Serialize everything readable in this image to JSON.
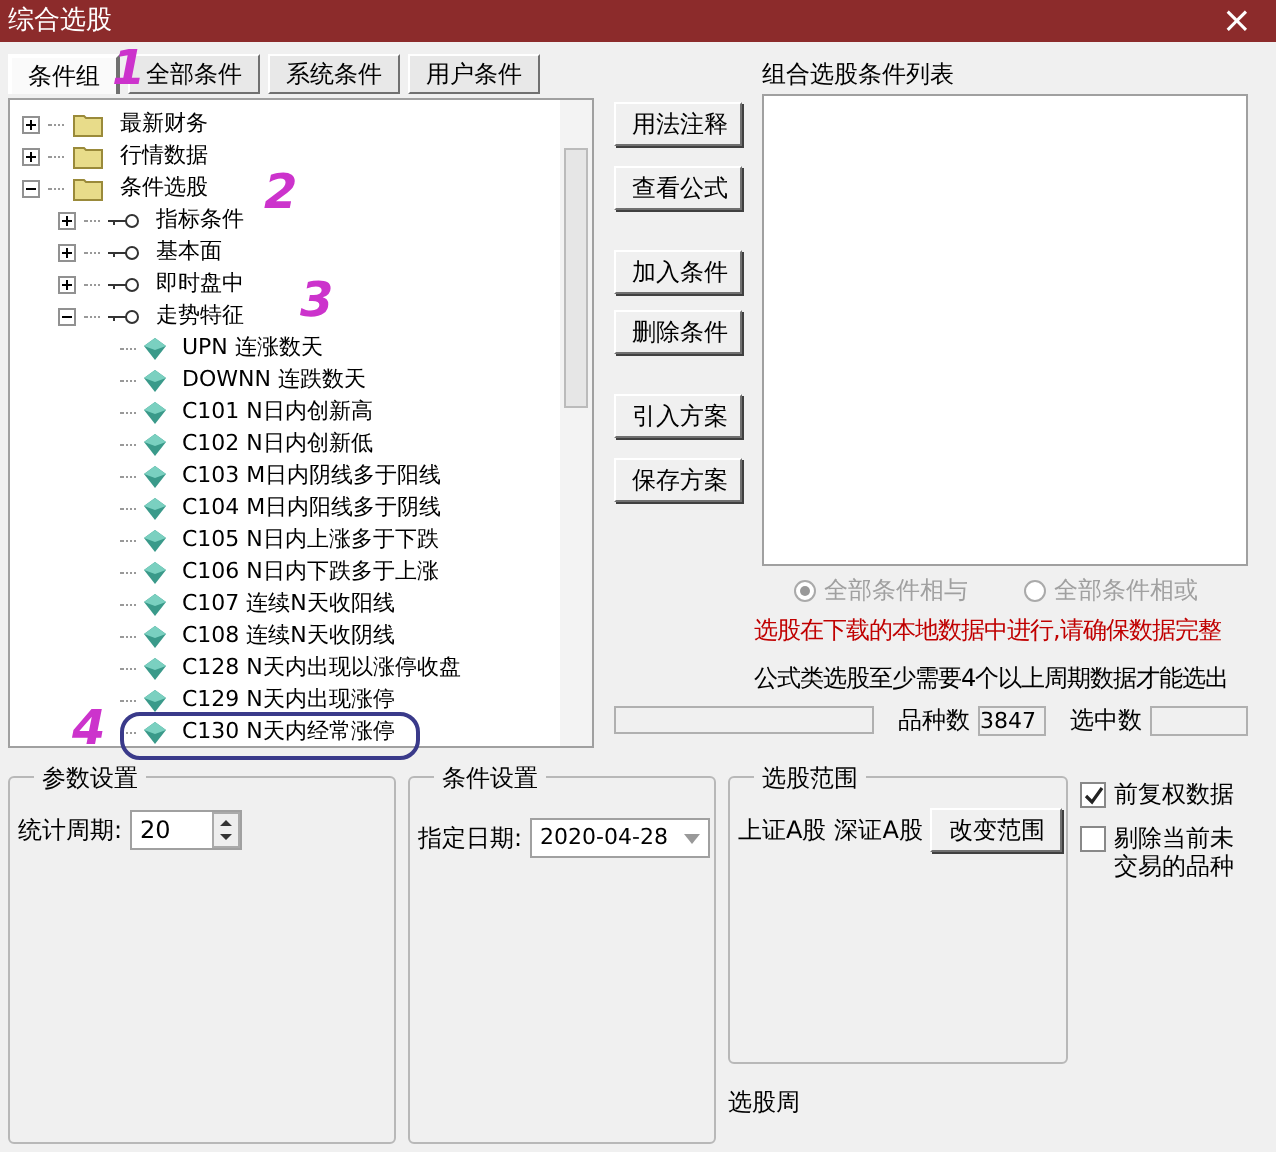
{
  "window": {
    "title": "综合选股",
    "close": "×"
  },
  "tabs": [
    {
      "label": "条件组",
      "selected": true
    },
    {
      "label": "全部条件",
      "selected": false
    },
    {
      "label": "系统条件",
      "selected": false
    },
    {
      "label": "用户条件",
      "selected": false
    }
  ],
  "tree": [
    {
      "kind": "folder",
      "label": "最新财务",
      "expanded": false
    },
    {
      "kind": "folder",
      "label": "行情数据",
      "expanded": false
    },
    {
      "kind": "folder",
      "label": "条件选股",
      "expanded": true,
      "children": [
        {
          "kind": "group",
          "label": "指标条件",
          "expanded": false
        },
        {
          "kind": "group",
          "label": "基本面",
          "expanded": false
        },
        {
          "kind": "group",
          "label": "即时盘中",
          "expanded": false
        },
        {
          "kind": "group",
          "label": "走势特征",
          "expanded": true,
          "children": [
            {
              "kind": "formula",
              "label": "UPN 连涨数天"
            },
            {
              "kind": "formula",
              "label": "DOWNN 连跌数天"
            },
            {
              "kind": "formula",
              "label": "C101 N日内创新高"
            },
            {
              "kind": "formula",
              "label": "C102 N日内创新低"
            },
            {
              "kind": "formula",
              "label": "C103 M日内阴线多于阳线"
            },
            {
              "kind": "formula",
              "label": "C104 M日内阳线多于阴线"
            },
            {
              "kind": "formula",
              "label": "C105 N日内上涨多于下跌"
            },
            {
              "kind": "formula",
              "label": "C106 N日内下跌多于上涨"
            },
            {
              "kind": "formula",
              "label": "C107 连续N天收阳线"
            },
            {
              "kind": "formula",
              "label": "C108 连续N天收阴线"
            },
            {
              "kind": "formula",
              "label": "C128 N天内出现以涨停收盘"
            },
            {
              "kind": "formula",
              "label": "C129 N天内出现涨停"
            },
            {
              "kind": "formula",
              "label": "C130 N天内经常涨停"
            }
          ]
        }
      ]
    }
  ],
  "buttons": [
    {
      "label": "用法注释"
    },
    {
      "label": "查看公式"
    },
    {
      "label": "加入条件"
    },
    {
      "label": "删除条件"
    },
    {
      "label": "引入方案"
    },
    {
      "label": "保存方案"
    }
  ],
  "list_title": "组合选股条件列表",
  "logic": [
    {
      "label": "全部条件相与",
      "selected": true
    },
    {
      "label": "全部条件相或",
      "selected": false
    }
  ],
  "logic_disabled": true,
  "warning": "选股在下载的本地数据中进行,请确保数据完整",
  "note": "公式类选股至少需要4个以上周期数据才能选出",
  "status": {
    "level": 0,
    "count_label": "品种数",
    "count": "3847",
    "selected_label": "选中数"
  },
  "params": {
    "title": "参数设置",
    "label": "统计周期:",
    "value": "20"
  },
  "conditions": {
    "title": "条件设置",
    "label": "指定日期:",
    "value": "2020-04-28"
  },
  "scope": {
    "title": "选股范围",
    "markets": [
      "上证A股",
      "深证A股"
    ],
    "button": "改变范围",
    "period_label": "选股周"
  },
  "options": [
    {
      "label": "前复权数据",
      "checked": true
    },
    {
      "label": "剔除当前未交易的品种",
      "checked": false
    }
  ],
  "annotations": [
    "1",
    "2",
    "3",
    "4"
  ]
}
